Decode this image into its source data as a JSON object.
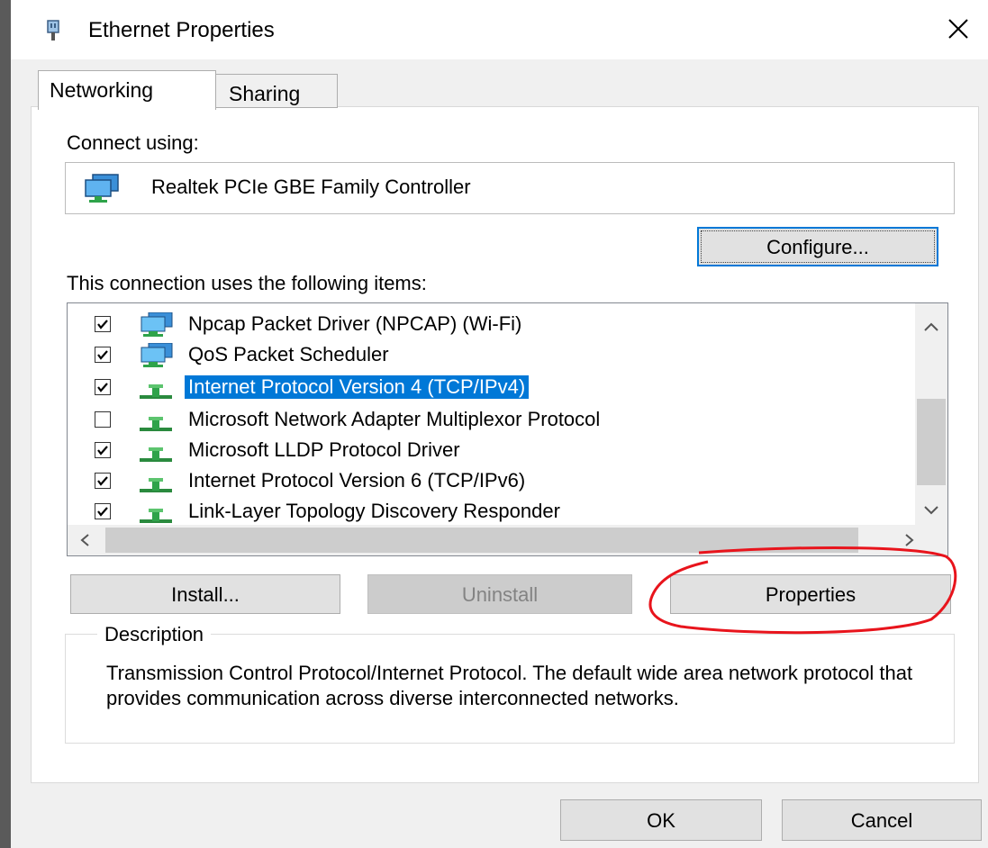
{
  "window": {
    "title": "Ethernet Properties",
    "close_glyph": "✕"
  },
  "tabs": [
    {
      "label": "Networking",
      "active": true
    },
    {
      "label": "Sharing",
      "active": false
    }
  ],
  "connect_using": {
    "label": "Connect using:",
    "adapter_name": "Realtek PCIe GBE Family Controller",
    "adapter_icon": "network-adapter-icon",
    "configure_button": "Configure..."
  },
  "items": {
    "label": "This connection uses the following items:",
    "list": [
      {
        "label": "Npcap Packet Driver (NPCAP) (Wi-Fi)",
        "checked": true,
        "icon": "network-client-icon",
        "selected": false
      },
      {
        "label": "QoS Packet Scheduler",
        "checked": true,
        "icon": "network-client-icon",
        "selected": false
      },
      {
        "label": "Internet Protocol Version 4 (TCP/IPv4)",
        "checked": true,
        "icon": "protocol-icon",
        "selected": true
      },
      {
        "label": "Microsoft Network Adapter Multiplexor Protocol",
        "checked": false,
        "icon": "protocol-icon",
        "selected": false
      },
      {
        "label": "Microsoft LLDP Protocol Driver",
        "checked": true,
        "icon": "protocol-icon",
        "selected": false
      },
      {
        "label": "Internet Protocol Version 6 (TCP/IPv6)",
        "checked": true,
        "icon": "protocol-icon",
        "selected": false
      },
      {
        "label": "Link-Layer Topology Discovery Responder",
        "checked": true,
        "icon": "protocol-icon",
        "selected": false
      }
    ]
  },
  "buttons": {
    "install": "Install...",
    "uninstall": "Uninstall",
    "properties": "Properties",
    "ok": "OK",
    "cancel": "Cancel"
  },
  "description": {
    "legend": "Description",
    "text": "Transmission Control Protocol/Internet Protocol. The default wide area network protocol that provides communication across diverse interconnected networks."
  },
  "colors": {
    "selection": "#0078d7",
    "annotation": "#e8141c",
    "dialog_bg": "#f0f0f0"
  }
}
